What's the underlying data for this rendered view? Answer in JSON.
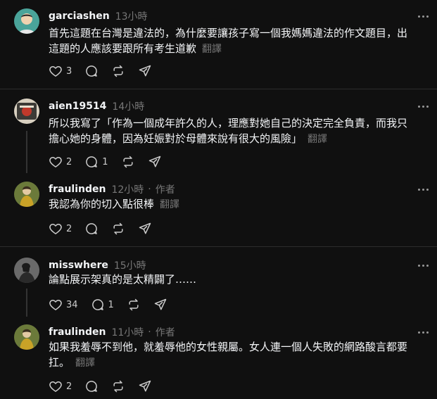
{
  "posts": [
    {
      "username": "garciashen",
      "time": "13小時",
      "text": "首先這題在台灣是違法的，為什麼要讓孩子寫一個我媽媽違法的作文題目，出這題的人應該要跟所有考生道歉",
      "translate": "翻譯",
      "likes": "3",
      "replies": "",
      "author_tag": ""
    },
    {
      "username": "aien19514",
      "time": "14小時",
      "text": "所以我寫了「作為一個成年許久的人，理應對她自己的決定完全負責，而我只擔心她的身體，因為妊娠對於母體來說有很大的風險」",
      "translate": "翻譯",
      "likes": "2",
      "replies": "1",
      "author_tag": ""
    },
    {
      "username": "fraulinden",
      "time": "12小時",
      "text": "我認為你的切入點很棒",
      "translate": "翻譯",
      "likes": "2",
      "replies": "",
      "author_tag": "作者"
    },
    {
      "username": "misswhere",
      "time": "15小時",
      "text": "論點展示架真的是太精闢了……",
      "translate": "",
      "likes": "34",
      "replies": "1",
      "author_tag": ""
    },
    {
      "username": "fraulinden",
      "time": "11小時",
      "text": "如果我羞辱不到他，就羞辱他的女性親屬。女人連一個人失敗的網路酸言都要扛。",
      "translate": "翻譯",
      "likes": "2",
      "replies": "",
      "author_tag": "作者"
    }
  ],
  "ui": {
    "separator": "·"
  }
}
